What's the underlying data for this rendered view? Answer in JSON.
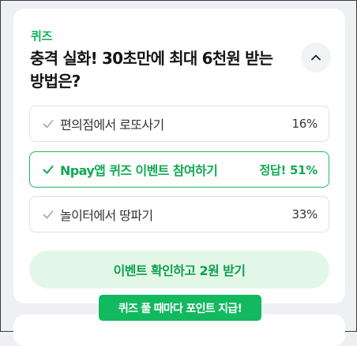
{
  "quiz": {
    "tag": "퀴즈",
    "title": "충격 실화! 30초만에 최대 6천원 받는 방법은?",
    "colors": {
      "accent": "#10b35a",
      "correct_border": "#1db861",
      "cta_background": "#e3f7e8",
      "badge_background": "#12b95f"
    },
    "collapse_icon": "chevron-up-icon",
    "options": [
      {
        "label": "편의점에서 로또사기",
        "result": "16%",
        "percent": 16,
        "correct": false,
        "icon": "check-icon"
      },
      {
        "label": "Npay앱 퀴즈 이벤트 참여하기",
        "result": "정답! 51%",
        "percent": 51,
        "correct": true,
        "icon": "check-icon"
      },
      {
        "label": "놀이터에서 땅파기",
        "result": "33%",
        "percent": 33,
        "correct": false,
        "icon": "check-icon"
      }
    ],
    "cta_label": "이벤트 확인하고 2원 받기",
    "badge_text": "퀴즈 풀 때마다 포인트 지급!"
  }
}
